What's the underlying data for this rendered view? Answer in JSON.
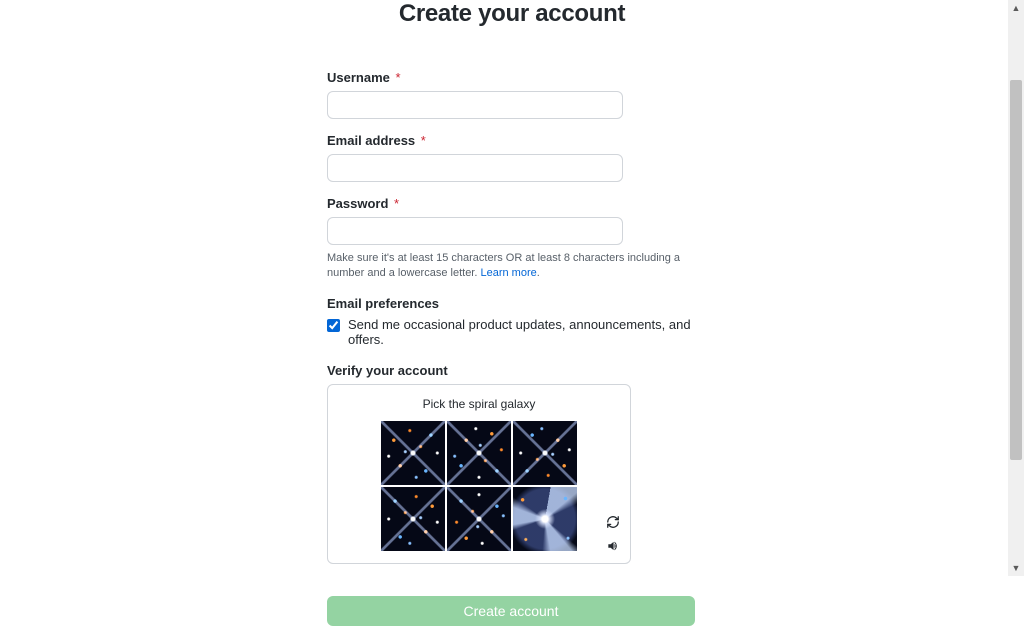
{
  "heading": "Create your account",
  "fields": {
    "username": {
      "label": "Username",
      "value": ""
    },
    "email": {
      "label": "Email address",
      "value": ""
    },
    "password": {
      "label": "Password",
      "value": ""
    }
  },
  "password_hint": "Make sure it's at least 15 characters OR at least 8 characters including a number and a lowercase letter. ",
  "password_hint_link": "Learn more",
  "email_prefs_label": "Email preferences",
  "email_prefs_checkbox_label": "Send me occasional product updates, announcements, and offers.",
  "email_prefs_checked": true,
  "verify_label": "Verify your account",
  "captcha": {
    "instruction": "Pick the spiral galaxy",
    "tiles": [
      "cluster",
      "cluster",
      "cluster",
      "cluster",
      "cluster",
      "spiral"
    ]
  },
  "submit_label": "Create account",
  "required_marker": "*"
}
